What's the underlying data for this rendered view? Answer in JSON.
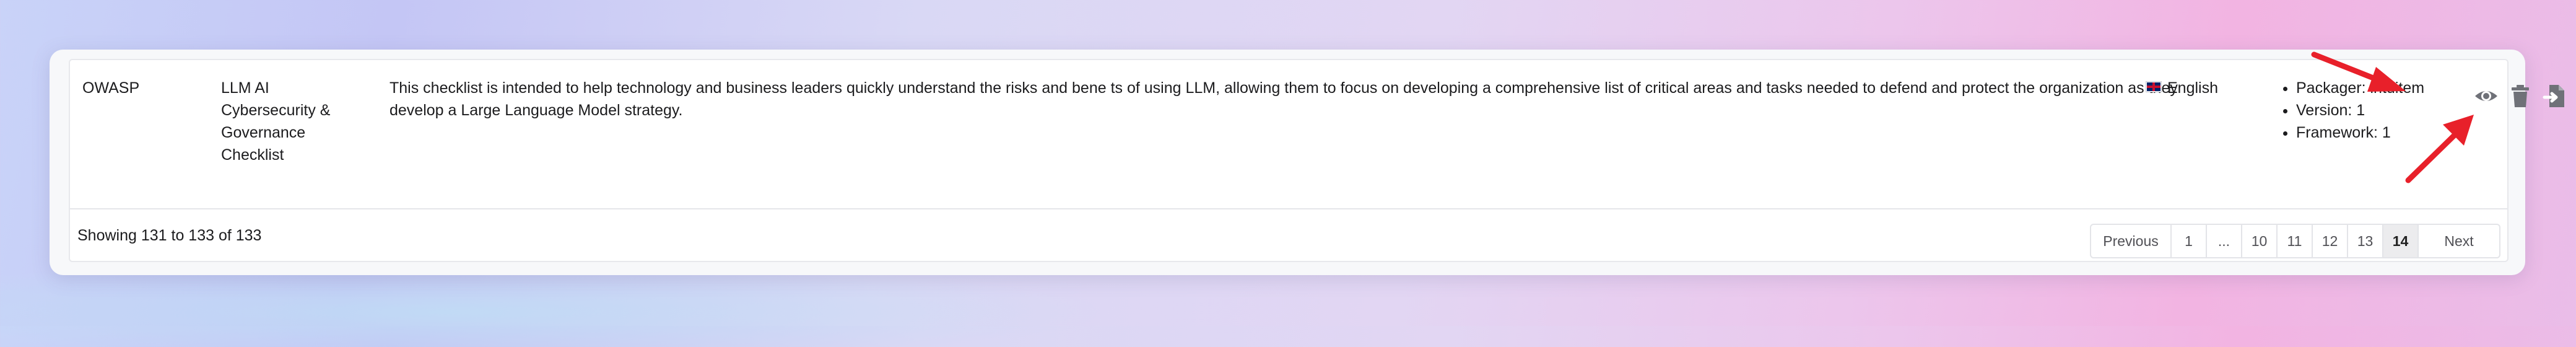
{
  "row": {
    "author": "OWASP",
    "name": "LLM AI Cybersecurity & Governance Checklist",
    "description": "This checklist is intended to help technology and business leaders quickly understand the risks and bene ts of using LLM, allowing them to focus on developing a comprehensive list of critical areas and tasks needed to defend and protect the organization as they develop a Large Language Model strategy.",
    "language": "English",
    "meta": [
      "Packager: intuitem",
      "Version: 1",
      "Framework: 1"
    ],
    "actions": [
      {
        "icon": "eye-icon"
      },
      {
        "icon": "trash-icon"
      },
      {
        "icon": "import-file-icon"
      }
    ]
  },
  "footer": {
    "showing": "Showing 131 to 133 of 133",
    "pagination": [
      "Previous",
      "1",
      "...",
      "10",
      "11",
      "12",
      "13",
      "14",
      "Next"
    ],
    "active_page": "14"
  },
  "annotation_color": "#e8202a"
}
